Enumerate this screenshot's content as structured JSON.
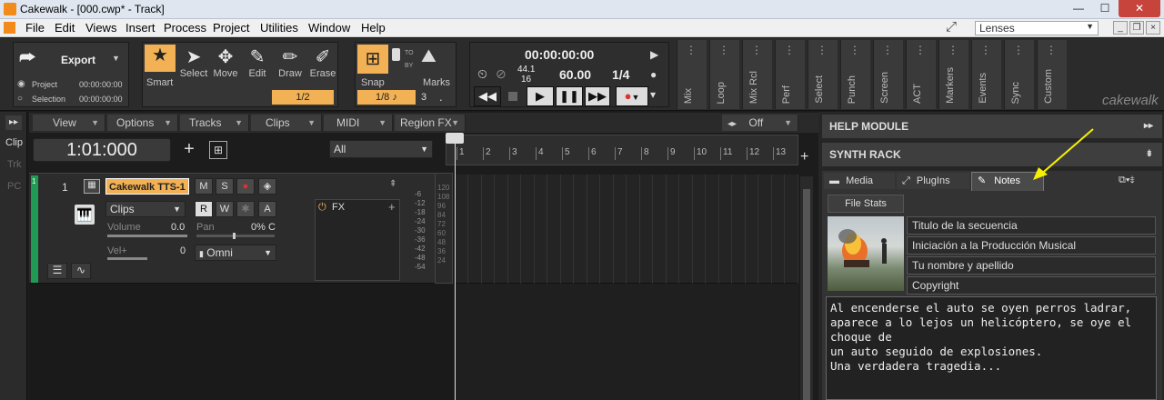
{
  "window": {
    "title": "Cakewalk - [000.cwp* - Track]",
    "minimize": "—",
    "maximize": "☐",
    "close": "✕"
  },
  "menu": {
    "items": [
      "File",
      "Edit",
      "Views",
      "Insert",
      "Process",
      "Project",
      "Utilities",
      "Window",
      "Help"
    ],
    "lenses": "Lenses"
  },
  "export": {
    "label": "Export",
    "radio_project": "Project",
    "radio_selection": "Selection",
    "time_project": "00:00:00:00",
    "time_selection": "00:00:00:00"
  },
  "tools": [
    {
      "label": "Smart",
      "icon": "star-icon",
      "glyph": "★"
    },
    {
      "label": "Select",
      "icon": "cursor-icon",
      "glyph": "➤"
    },
    {
      "label": "Move",
      "icon": "move-icon",
      "glyph": "✥"
    },
    {
      "label": "Edit",
      "icon": "edit-icon",
      "glyph": "✎"
    },
    {
      "label": "Draw",
      "icon": "pencil-icon",
      "glyph": "✏"
    },
    {
      "label": "Erase",
      "icon": "eraser-icon",
      "glyph": "✐"
    }
  ],
  "draw_value": "1/2",
  "snap": {
    "label": "Snap",
    "to": "TO",
    "by": "BY",
    "value": "1/8",
    "marks": "Marks",
    "marks_value": "3",
    "dot": "."
  },
  "transport": {
    "time": "00:00:00:00",
    "sample_rate": "44.1",
    "bit_depth": "16",
    "tempo": "60.00",
    "meter": "1/4"
  },
  "modules": [
    "Mix",
    "Loop",
    "Mix Rcl",
    "Perf",
    "Select",
    "Punch",
    "Screen",
    "ACT",
    "Markers",
    "Events",
    "Sync",
    "Custom"
  ],
  "brand": "cakewalk",
  "side_tabs": [
    "Clip",
    "Trk",
    "PC"
  ],
  "track_menus": [
    "View",
    "Options",
    "Tracks",
    "Clips",
    "MIDI",
    "Region FX"
  ],
  "off_label": "Off",
  "now_time": "1:01:000",
  "filter": "All",
  "ruler": [
    "1",
    "2",
    "3",
    "4",
    "5",
    "6",
    "7",
    "8",
    "9",
    "10",
    "11",
    "12",
    "13"
  ],
  "track": {
    "number": "1",
    "name": "Cakewalk TTS-1",
    "m": "M",
    "s": "S",
    "r": "R",
    "w": "W",
    "star": "✱",
    "a": "A",
    "clips": "Clips",
    "volume": "Volume",
    "volume_val": "0.0",
    "pan": "Pan",
    "pan_val": "0% C",
    "vel": "Vel+",
    "vel_val": "0",
    "input": "Omni",
    "fx": "FX"
  },
  "meter_scale": [
    "-6",
    "-12",
    "-18",
    "-24",
    "-30",
    "-36",
    "-42",
    "-48",
    "-54"
  ],
  "meter_scale2": [
    "120",
    "108",
    "96",
    "84",
    "72",
    "60",
    "48",
    "36",
    "24"
  ],
  "right": {
    "help": "HELP MODULE",
    "synth": "SYNTH RACK",
    "tabs": [
      "Media",
      "PlugIns",
      "Notes"
    ],
    "file_stats": "File Stats",
    "fields": [
      "Titulo de la secuencia",
      "Iniciación a la Producción Musical",
      "Tu nombre y apellido",
      "Copyright"
    ],
    "notes": "Al encenderse el auto se oyen perros ladrar,\naparece a lo lejos un helicóptero, se oye el choque de\nun auto seguido de explosiones.\nUna verdadera tragedia..."
  },
  "colors": {
    "accent": "#f2b154",
    "record": "#e03030",
    "track_green": "#1f9b54",
    "annotation": "#f5f000"
  }
}
